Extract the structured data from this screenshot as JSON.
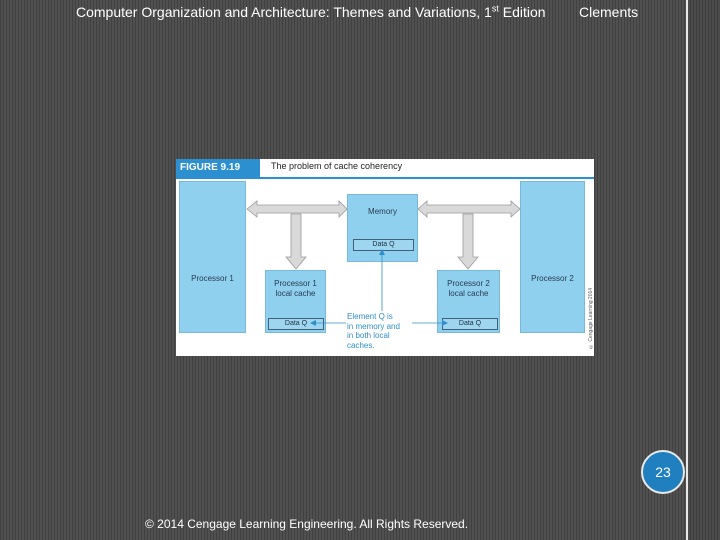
{
  "header": {
    "title": "Computer Organization and Architecture: Themes and Variations, 1",
    "title_superscript": "st",
    "title_suffix": " Edition",
    "author": "Clements"
  },
  "page_number": "23",
  "footer": {
    "copyright": "© 2014 Cengage Learning Engineering. All Rights Reserved."
  },
  "figure": {
    "label": "FIGURE 9.19",
    "caption": "The problem of cache coherency",
    "processor1": "Processor 1",
    "processor2": "Processor 2",
    "memory": "Memory",
    "memory_data": "Data Q",
    "cache1_line1": "Processor 1",
    "cache1_line2": "local cache",
    "cache1_data": "Data Q",
    "cache2_line1": "Processor 2",
    "cache2_line2": "local cache",
    "cache2_data": "Data Q",
    "note_lines": [
      "Element Q is",
      "in memory and",
      "in both local",
      "caches."
    ],
    "side_credit": "© Cengage Learning 2014"
  },
  "colors": {
    "accent": "#1f7fbf",
    "figure_blue": "#2c8fd0",
    "box_fill": "#8fd0ee"
  }
}
